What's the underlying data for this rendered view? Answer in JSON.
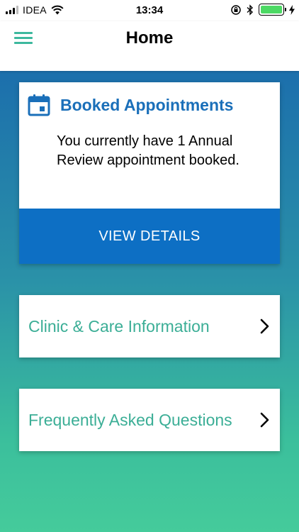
{
  "status_bar": {
    "carrier": "IDEA",
    "time": "13:34"
  },
  "header": {
    "title": "Home",
    "menu_icon": "hamburger-icon"
  },
  "appointments_card": {
    "icon": "calendar-icon",
    "title": "Booked Appointments",
    "message": "You currently have 1 Annual Review appointment booked.",
    "button_label": "VIEW DETAILS"
  },
  "links": {
    "clinic": "Clinic & Care Information",
    "faq": "Frequently Asked Questions"
  },
  "colors": {
    "accent_teal": "#3bae96",
    "primary_blue": "#0d6fc4",
    "title_blue": "#1a6fb9"
  }
}
